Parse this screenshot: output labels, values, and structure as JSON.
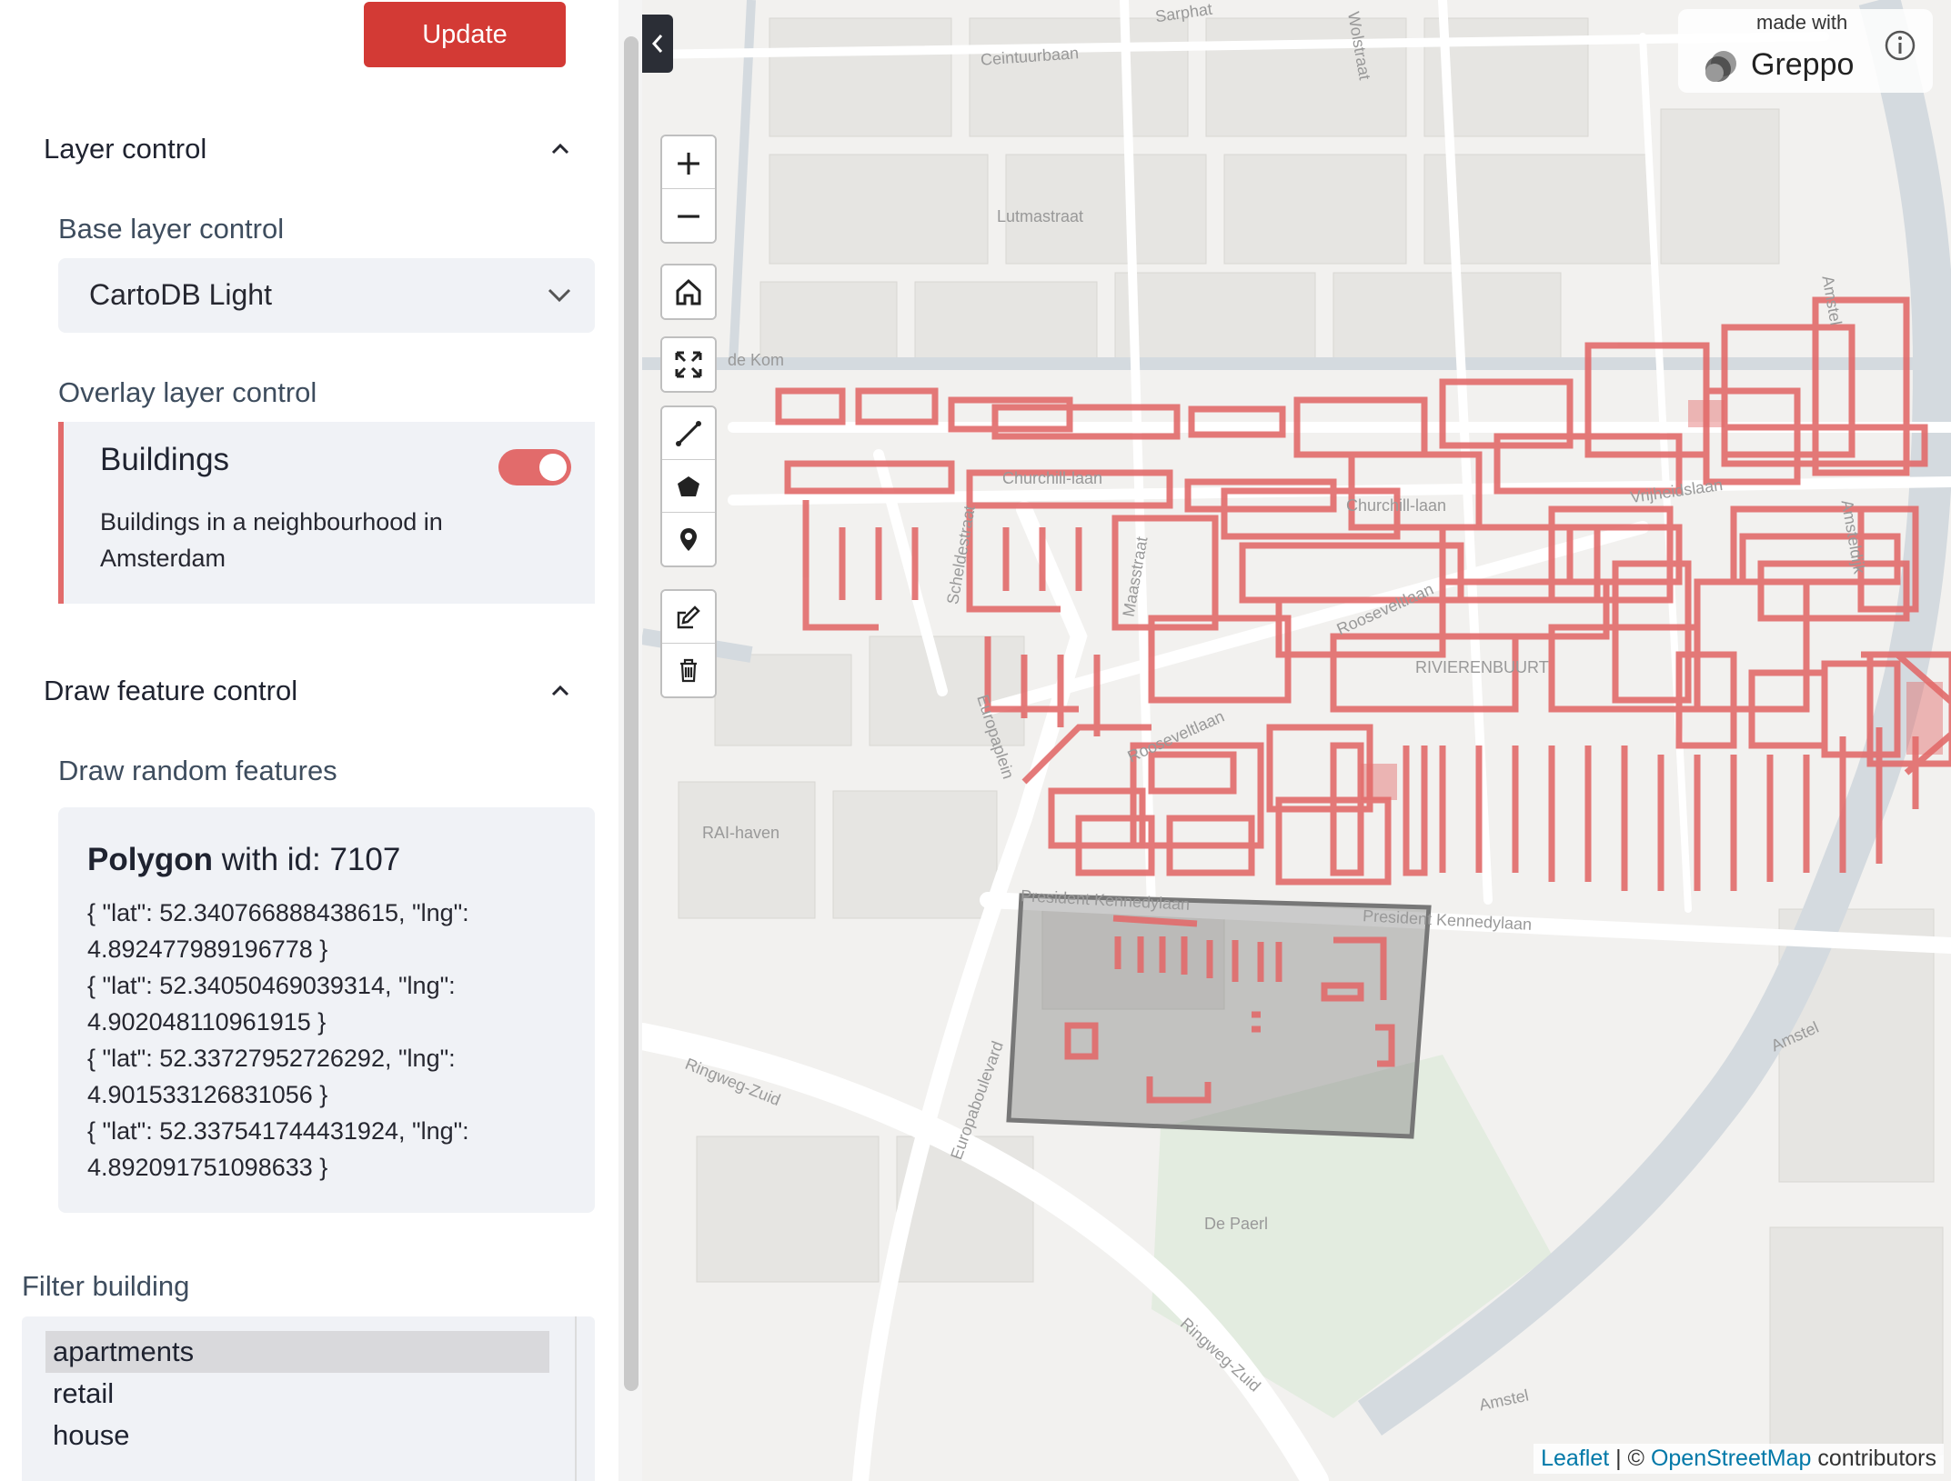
{
  "sidebar": {
    "update_label": "Update",
    "layer_control": {
      "title": "Layer control",
      "base_title": "Base layer control",
      "base_selected": "CartoDB Light",
      "overlay_title": "Overlay layer control",
      "overlay": {
        "name": "Buildings",
        "description": "Buildings in a neighbourhood in Amsterdam",
        "enabled": true,
        "color": "#e26b6b"
      }
    },
    "draw_control": {
      "title": "Draw feature control",
      "subtitle": "Draw random features",
      "feature": {
        "type_label": "Polygon",
        "id_text": "with id: 7107",
        "coords": [
          "{ \"lat\": 52.340766888438615, \"lng\":",
          "4.892477989196778 }",
          "{ \"lat\": 52.34050469039314, \"lng\":",
          "4.902048110961915 }",
          "{ \"lat\": 52.33727952726292, \"lng\":",
          "4.901533126831056 }",
          "{ \"lat\": 52.337541744431924, \"lng\":",
          "4.892091751098633 }"
        ]
      }
    },
    "filter": {
      "title": "Filter building",
      "options": [
        "apartments",
        "retail",
        "house"
      ],
      "selected": "apartments"
    }
  },
  "map": {
    "controls": [
      "zoom-in",
      "zoom-out",
      "home",
      "fullscreen",
      "draw-polyline",
      "draw-polygon",
      "draw-marker",
      "edit",
      "delete"
    ],
    "zoom_in": "+",
    "zoom_out": "−",
    "greppo": {
      "made_with": "made with",
      "name": "Greppo"
    },
    "attribution": {
      "leaflet": "Leaflet",
      "sep": " | © ",
      "osm": "OpenStreetMap",
      "suffix": " contributors"
    },
    "street_labels": {
      "ceintuurbaan": "Ceintuurbaan",
      "lutmastraat": "Lutmastraat",
      "dekom": "de Kom",
      "churchill1": "Churchill-laan",
      "churchill2": "Churchill-laan",
      "vrijheidslaan": "Vrijheidslaan",
      "amsteldijk": "Amsteldijk",
      "amstel1": "Amstel",
      "amstel2": "Amstel",
      "amstel3": "Amstel",
      "scheldestraat": "Scheldestraat",
      "maasstraat": "Maasstraat",
      "rooseveltlaan1": "Rooseveltlaan",
      "rooseveltlaan2": "Rooseveltlaan",
      "rivierenbuurt": "RIVIERENBUURT",
      "europaplein": "Europaplein",
      "raihaven": "RAI-haven",
      "kennedylaan1": "President Kennedylaan",
      "kennedylaan2": "President Kennedylaan",
      "ringwegzuid1": "Ringweg-Zuid",
      "ringwegzuid2": "Ringweg-Zuid",
      "europaboulevard": "Europaboulevard",
      "depaerl": "De Paerl",
      "wolstraat": "Wolstraat",
      "sarphati": "Sarphat"
    }
  }
}
